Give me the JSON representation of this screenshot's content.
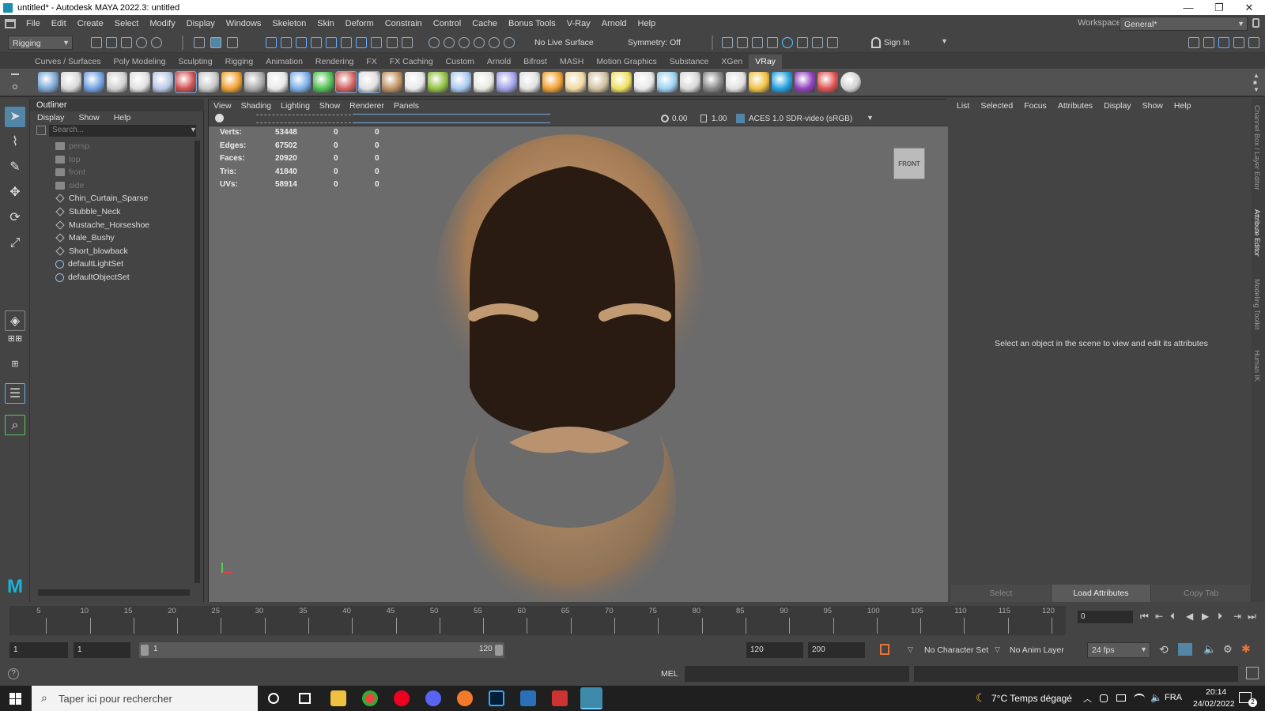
{
  "window": {
    "title": "untitled* - Autodesk MAYA 2022.3: untitled",
    "minimize": "—",
    "maximize": "❐",
    "close": "✕"
  },
  "menubar": {
    "items": [
      "File",
      "Edit",
      "Create",
      "Select",
      "Modify",
      "Display",
      "Windows",
      "Skeleton",
      "Skin",
      "Deform",
      "Constrain",
      "Control",
      "Cache",
      "Bonus Tools",
      "V-Ray",
      "Arnold",
      "Help"
    ],
    "workspace_label": "Workspace:",
    "workspace_value": "General*"
  },
  "statusline": {
    "menuset": "Rigging",
    "live_surface": "No Live Surface",
    "symmetry": "Symmetry: Off",
    "sign_in": "Sign In"
  },
  "shelf": {
    "tabs": [
      "Curves / Surfaces",
      "Poly Modeling",
      "Sculpting",
      "Rigging",
      "Animation",
      "Rendering",
      "FX",
      "FX Caching",
      "Custom",
      "Arnold",
      "Bifrost",
      "MASH",
      "Motion Graphics",
      "Substance",
      "XGen",
      "VRay"
    ],
    "active_tab": "VRay"
  },
  "outliner": {
    "title": "Outliner",
    "menu": [
      "Display",
      "Show",
      "Help"
    ],
    "search_placeholder": "Search...",
    "items": [
      {
        "label": "persp",
        "type": "camera",
        "dim": true
      },
      {
        "label": "top",
        "type": "camera",
        "dim": true
      },
      {
        "label": "front",
        "type": "camera",
        "dim": true
      },
      {
        "label": "side",
        "type": "camera",
        "dim": true
      },
      {
        "label": "Chin_Curtain_Sparse",
        "type": "mesh",
        "dim": false
      },
      {
        "label": "Stubble_Neck",
        "type": "mesh",
        "dim": false
      },
      {
        "label": "Mustache_Horseshoe",
        "type": "mesh",
        "dim": false
      },
      {
        "label": "Male_Bushy",
        "type": "mesh",
        "dim": false
      },
      {
        "label": "Short_blowback",
        "type": "mesh",
        "dim": false
      },
      {
        "label": "defaultLightSet",
        "type": "set",
        "dim": false
      },
      {
        "label": "defaultObjectSet",
        "type": "set",
        "dim": false
      }
    ]
  },
  "viewport": {
    "menu": [
      "View",
      "Shading",
      "Lighting",
      "Show",
      "Renderer",
      "Panels"
    ],
    "exposure": "0.00",
    "gamma": "1.00",
    "color_space": "ACES 1.0 SDR-video (sRGB)",
    "view_cube_label": "FRONT",
    "hud": [
      {
        "label": "Verts:",
        "v1": "53448",
        "v2": "0",
        "v3": "0"
      },
      {
        "label": "Edges:",
        "v1": "67502",
        "v2": "0",
        "v3": "0"
      },
      {
        "label": "Faces:",
        "v1": "20920",
        "v2": "0",
        "v3": "0"
      },
      {
        "label": "Tris:",
        "v1": "41840",
        "v2": "0",
        "v3": "0"
      },
      {
        "label": "UVs:",
        "v1": "58914",
        "v2": "0",
        "v3": "0"
      }
    ]
  },
  "attribute_editor": {
    "menu": [
      "List",
      "Selected",
      "Focus",
      "Attributes",
      "Display",
      "Show",
      "Help"
    ],
    "message": "Select an object in the scene to view and edit its attributes",
    "buttons": [
      "Select",
      "Load Attributes",
      "Copy Tab"
    ],
    "side_tabs": [
      "Channel Box / Layer Editor",
      "Attribute Editor",
      "Modeling Toolkit",
      "Human IK"
    ]
  },
  "timeslider": {
    "ticks": [
      "5",
      "10",
      "15",
      "20",
      "25",
      "30",
      "35",
      "40",
      "45",
      "50",
      "55",
      "60",
      "65",
      "70",
      "75",
      "80",
      "85",
      "90",
      "95",
      "100",
      "105",
      "110",
      "115",
      "120"
    ],
    "current_frame": "0"
  },
  "rangeslider": {
    "start": "1",
    "anim_start": "1",
    "range_start": "1",
    "range_end": "120",
    "end": "120",
    "anim_end": "200",
    "character_set": "No Character Set",
    "anim_layer": "No Anim Layer",
    "fps": "24 fps"
  },
  "cmdline": {
    "lang": "MEL"
  },
  "taskbar": {
    "search_placeholder": "Taper ici pour rechercher",
    "weather": "7°C  Temps dégagé",
    "lang": "FRA",
    "time": "20:14",
    "date": "24/02/2022",
    "notif_count": "2"
  },
  "colors": {
    "accent": "#5285a6",
    "bg": "#444444",
    "viewport": "#6b6b6b"
  }
}
